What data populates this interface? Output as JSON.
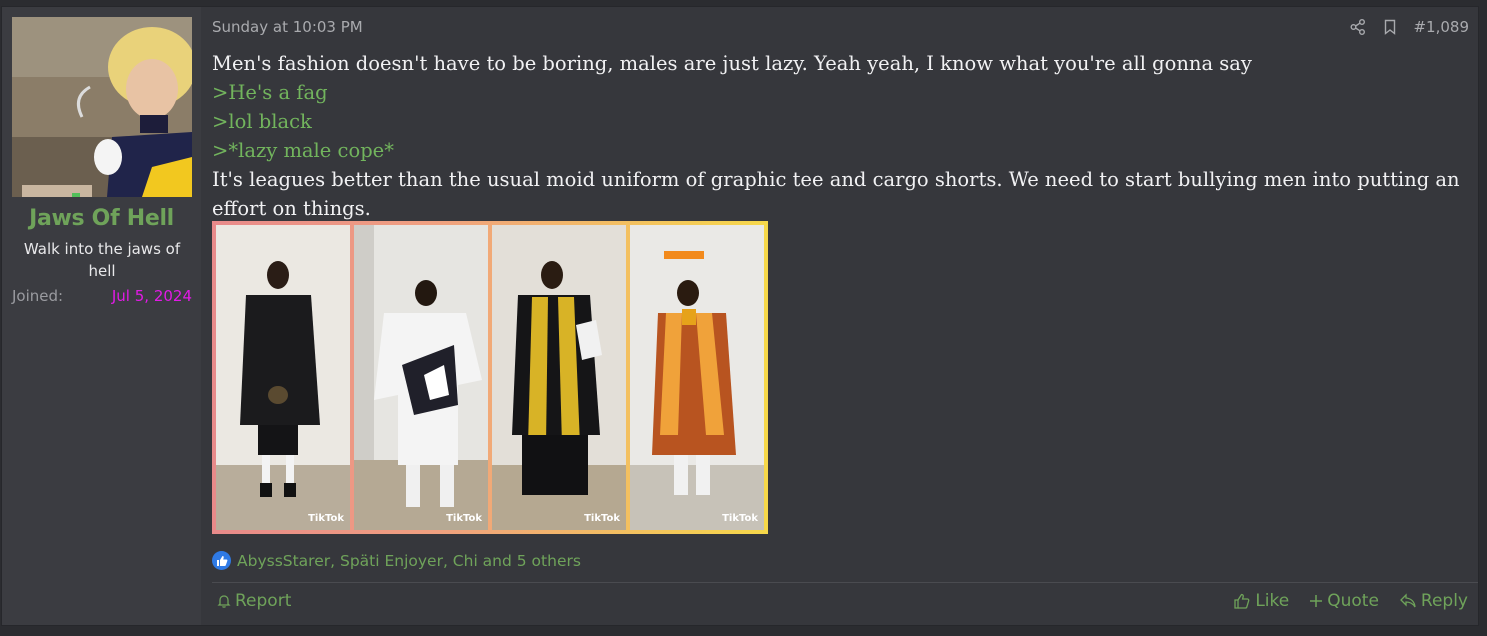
{
  "user": {
    "name": "Jaws Of Hell",
    "title": "Walk into the jaws of hell",
    "joined_label": "Joined:",
    "joined_value": "Jul 5, 2024"
  },
  "post": {
    "timestamp": "Sunday at 10:03 PM",
    "number": "#1,089",
    "lines": {
      "l1": "Men's fashion doesn't have to be boring, males are just lazy. Yeah yeah, I know what you're all gonna say",
      "q1": ">He's a fag",
      "q2": ">lol black",
      "q3": ">*lazy male cope*",
      "l2": "It's leagues better than the usual moid uniform of graphic tee and cargo shorts. We need to start bullying men into putting an effort on things."
    },
    "image_watermark": "TikTok",
    "reactions": "AbyssStarer, Späti Enjoyer, Chi and 5 others"
  },
  "footer": {
    "report": "Report",
    "like": "Like",
    "quote": "Quote",
    "reply": "Reply"
  },
  "colors": {
    "accent_green": "#6fa35a",
    "joined_magenta": "#e21ae6",
    "quote_green": "#72b45d",
    "panel_bg": "#36373c"
  }
}
